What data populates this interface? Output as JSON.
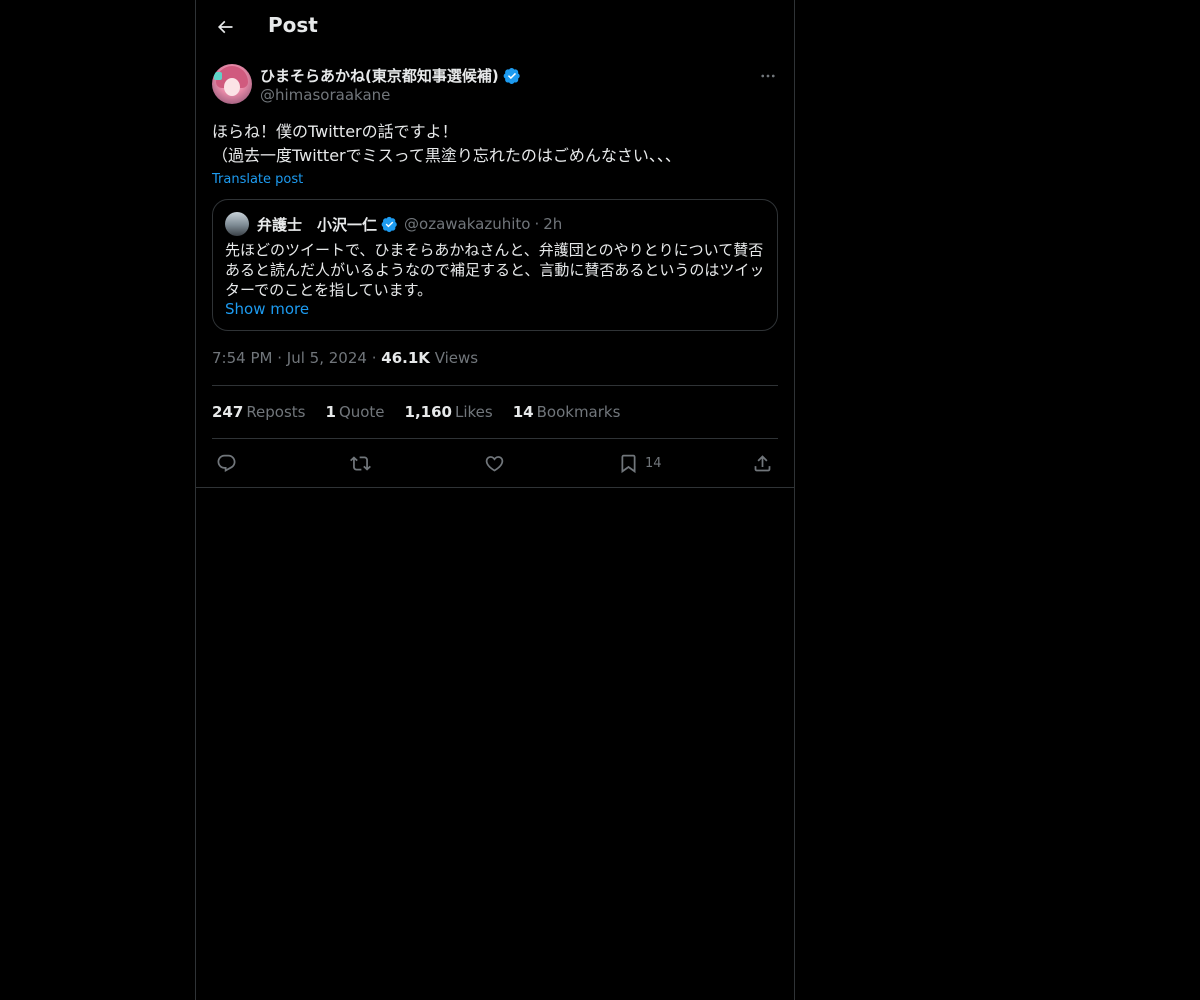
{
  "header": {
    "title": "Post"
  },
  "post": {
    "author": {
      "display_name": "ひまそらあかね(東京都知事選候補)",
      "handle": "@himasoraakane",
      "verified": true
    },
    "text": "ほらね！僕のTwitterの話ですよ！\n（過去一度Twitterでミスって黒塗り忘れたのはごめんなさい、、、",
    "translate_label": "Translate post",
    "quote": {
      "display_name": "弁護士　小沢一仁",
      "handle": "@ozawakazuhito",
      "dot": "·",
      "time": "2h",
      "verified": true,
      "text": "先ほどのツイートで、ひまそらあかねさんと、弁護団とのやりとりについて賛否あると読んだ人がいるようなので補足すると、言動に賛否あるというのはツイッターでのことを指しています。",
      "show_more": "Show more"
    },
    "time": "7:54 PM",
    "date": "Jul 5, 2024",
    "dot": "·",
    "views_count": "46.1K",
    "views_label": "Views",
    "stats": {
      "reposts_count": "247",
      "reposts_label": "Reposts",
      "quotes_count": "1",
      "quotes_label": "Quote",
      "likes_count": "1,160",
      "likes_label": "Likes",
      "bookmarks_count": "14",
      "bookmarks_label": "Bookmarks"
    },
    "actions": {
      "bookmark_count": "14"
    }
  },
  "icons": {
    "back": "arrow-left-icon",
    "more": "more-horizontal-icon",
    "verified": "verified-badge-icon",
    "reply": "reply-icon",
    "repost": "repost-icon",
    "like": "heart-icon",
    "bookmark": "bookmark-icon",
    "share": "share-icon"
  },
  "colors": {
    "background": "#000000",
    "text": "#e7e9ea",
    "secondary": "#71767b",
    "accent": "#1d9bf0",
    "border": "#2f3336"
  }
}
